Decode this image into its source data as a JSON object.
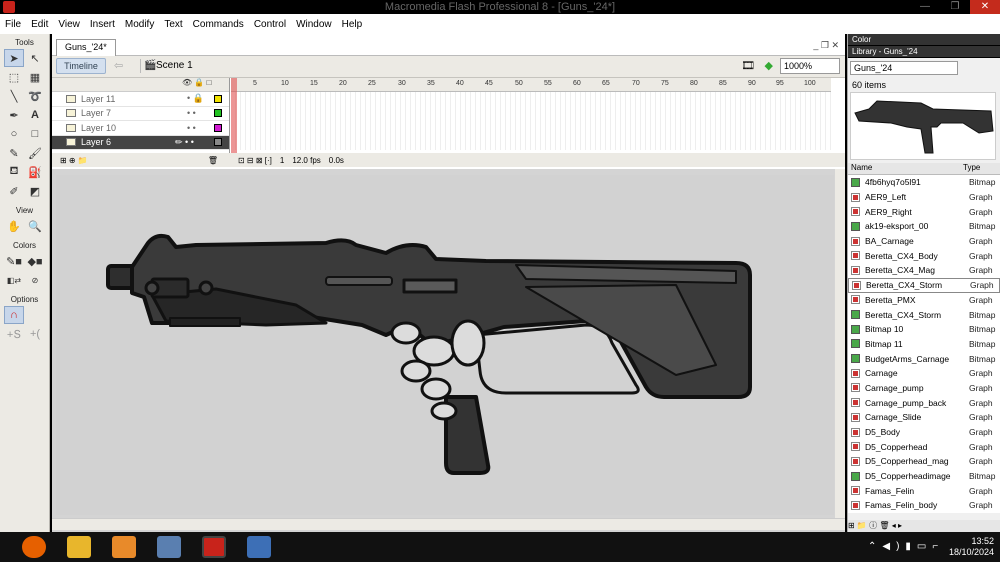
{
  "window": {
    "title": "Macromedia Flash Professional 8 - [Guns_'24*]",
    "min": "—",
    "max": "❐",
    "close": "✕"
  },
  "menu": [
    "File",
    "Edit",
    "View",
    "Insert",
    "Modify",
    "Text",
    "Commands",
    "Control",
    "Window",
    "Help"
  ],
  "tools": {
    "header": "Tools",
    "view_header": "View",
    "colors_header": "Colors",
    "options_header": "Options"
  },
  "document": {
    "tab": "Guns_'24*",
    "timeline_btn": "Timeline",
    "scene": "Scene 1",
    "zoom": "1000%"
  },
  "timeline": {
    "layers": [
      {
        "name": "Layer 11",
        "color": "#f2e300"
      },
      {
        "name": "Layer 7",
        "color": "#22c322"
      },
      {
        "name": "Layer 10",
        "color": "#d21dd2"
      },
      {
        "name": "Layer 6",
        "color": "#888888"
      }
    ],
    "ruler": [
      "5",
      "10",
      "15",
      "20",
      "25",
      "30",
      "35",
      "40",
      "45",
      "50",
      "55",
      "60",
      "65",
      "70",
      "75",
      "80",
      "85",
      "90",
      "95",
      "100"
    ],
    "frame": "1",
    "fps": "12.0 fps",
    "time": "0.0s"
  },
  "panels": {
    "color": "Color",
    "library": "Library - Guns_'24"
  },
  "library": {
    "selector": "Guns_'24",
    "count": "60 items",
    "col_name": "Name",
    "col_type": "Type",
    "items": [
      {
        "name": "4fb6hyq7o5l91",
        "type": "Bitmap",
        "kind": "gr"
      },
      {
        "name": "AER9_Left",
        "type": "Graph",
        "kind": "bm"
      },
      {
        "name": "AER9_Right",
        "type": "Graph",
        "kind": "bm"
      },
      {
        "name": "ak19-eksport_00",
        "type": "Bitmap",
        "kind": "gr"
      },
      {
        "name": "BA_Carnage",
        "type": "Graph",
        "kind": "bm"
      },
      {
        "name": "Beretta_CX4_Body",
        "type": "Graph",
        "kind": "bm"
      },
      {
        "name": "Beretta_CX4_Mag",
        "type": "Graph",
        "kind": "bm"
      },
      {
        "name": "Beretta_CX4_Storm",
        "type": "Graph",
        "kind": "bm"
      },
      {
        "name": "Beretta_PMX",
        "type": "Graph",
        "kind": "bm"
      },
      {
        "name": "Beretta_CX4_Storm",
        "type": "Bitmap",
        "kind": "gr"
      },
      {
        "name": "Bitmap 10",
        "type": "Bitmap",
        "kind": "gr"
      },
      {
        "name": "Bitmap 11",
        "type": "Bitmap",
        "kind": "gr"
      },
      {
        "name": "BudgetArms_Carnage",
        "type": "Bitmap",
        "kind": "gr"
      },
      {
        "name": "Carnage",
        "type": "Graph",
        "kind": "bm"
      },
      {
        "name": "Carnage_pump",
        "type": "Graph",
        "kind": "bm"
      },
      {
        "name": "Carnage_pump_back",
        "type": "Graph",
        "kind": "bm"
      },
      {
        "name": "Carnage_Slide",
        "type": "Graph",
        "kind": "bm"
      },
      {
        "name": "D5_Body",
        "type": "Graph",
        "kind": "bm"
      },
      {
        "name": "D5_Copperhead",
        "type": "Graph",
        "kind": "bm"
      },
      {
        "name": "D5_Copperhead_mag",
        "type": "Graph",
        "kind": "bm"
      },
      {
        "name": "D5_Copperheadimage",
        "type": "Bitmap",
        "kind": "gr"
      },
      {
        "name": "Famas_Felin",
        "type": "Graph",
        "kind": "bm"
      },
      {
        "name": "Famas_Felin_body",
        "type": "Graph",
        "kind": "bm"
      }
    ]
  },
  "taskbar": {
    "time": "13:52",
    "date": "18/10/2024"
  }
}
